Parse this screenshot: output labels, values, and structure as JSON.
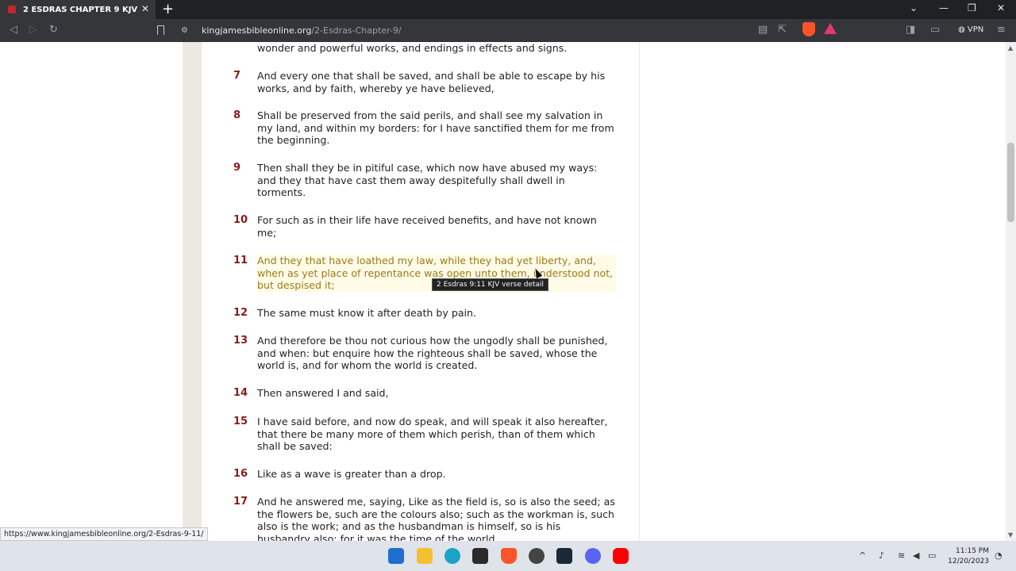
{
  "browser": {
    "tab_title": "2 ESDRAS CHAPTER 9 KJV",
    "tab_close": "✕",
    "new_tab": "+",
    "url_domain": "kingjamesbibleonline.org",
    "url_path": "/2-Esdras-Chapter-9/",
    "vpn_label": "VPN",
    "status_url": "https://www.kingjamesbibleonline.org/2-Esdras-9-11/"
  },
  "verses": [
    {
      "num": "",
      "text": "wonder and powerful works, and endings in effects and signs."
    },
    {
      "num": "7",
      "text": "And every one that shall be saved, and shall be able to escape by his works, and by faith, whereby ye have believed,"
    },
    {
      "num": "8",
      "text": "Shall be preserved from the said perils, and shall see my salvation in my land, and within my borders: for I have sanctified them for me from the beginning."
    },
    {
      "num": "9",
      "text": "Then shall they be in pitiful case, which now have abused my ways: and they that have cast them away despitefully shall dwell in torments."
    },
    {
      "num": "10",
      "text": "For such as in their life have received benefits, and have not known me;"
    },
    {
      "num": "11",
      "text": "And they that have loathed my law, while they had yet liberty, and, when as yet place of repentance was open unto them, understood not, but despised it;"
    },
    {
      "num": "12",
      "text": "The same must know it after death by pain."
    },
    {
      "num": "13",
      "text": "And therefore be thou not curious how the ungodly shall be punished, and when: but enquire how the righteous shall be saved, whose the world is, and for whom the world is created."
    },
    {
      "num": "14",
      "text": "Then answered I and said,"
    },
    {
      "num": "15",
      "text": "I have said before, and now do speak, and will speak it also hereafter, that there be many more of them which perish, than of them which shall be saved:"
    },
    {
      "num": "16",
      "text": "Like as a wave is greater than a drop."
    },
    {
      "num": "17",
      "text": "And he answered me, saying, Like as the field is, so is also the seed; as the flowers be, such are the colours also; such as the workman is, such also is the work; and as the husbandman is himself, so is his husbandry also: for it was the time of the world."
    }
  ],
  "tooltip": "2 Esdras 9:11 KJV verse detail",
  "taskbar": {
    "time": "11:15 PM",
    "date": "12/20/2023"
  },
  "colors": {
    "verse_number": "#8b1a1a",
    "highlight": "#9a7b1d"
  }
}
